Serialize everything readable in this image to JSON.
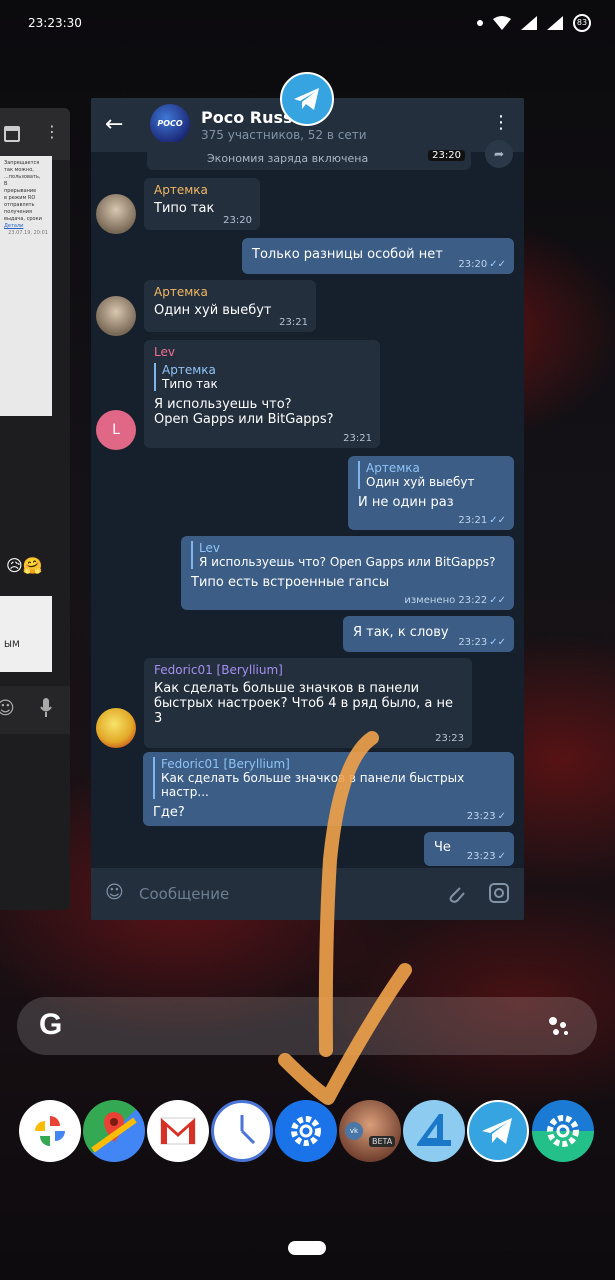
{
  "status_bar": {
    "time": "23:23:30",
    "battery": "83"
  },
  "left_card": {
    "doc_lines": [
      "Запрещается",
      "так можно,",
      "...пользовать,",
      "В",
      "прерывание",
      "в режим RO",
      "отправлять",
      "получения",
      "выдача, сроки"
    ],
    "doc_link": "Детали",
    "doc_date": "23.07.19, 20:01",
    "paper_text": "ЫМ"
  },
  "chat": {
    "title": "Poco Russia",
    "subtitle": "375 участников, 52 в сети",
    "avatar_text": "POCO",
    "service_text": "Экономия заряда включена",
    "service_time": "23:20",
    "input_placeholder": "Сообщение",
    "messages": [
      {
        "sender": "Артемка",
        "text": "Типо так",
        "time": "23:20"
      },
      {
        "text": "Только разницы особой нет",
        "time": "23:20",
        "status": "✓✓"
      },
      {
        "sender": "Артемка",
        "text": "Один хуй выебут",
        "time": "23:21"
      },
      {
        "sender": "Lev",
        "reply_name": "Артемка",
        "reply_text": "Типо так",
        "text_line1": "Я используешь что?",
        "text_line2": "Open Gapps или BitGapps?",
        "time": "23:21",
        "avatar_letter": "L"
      },
      {
        "reply_name": "Артемка",
        "reply_text": "Один хуй выебут",
        "text": "И не один раз",
        "time": "23:21",
        "status": "✓✓"
      },
      {
        "reply_name": "Lev",
        "reply_text": "Я используешь что?  Open Gapps или BitGapps?",
        "text": "Типо есть встроенные гапсы",
        "edited": "изменено",
        "time": "23:22",
        "status": "✓✓"
      },
      {
        "text": "Я так, к слову",
        "time": "23:23",
        "status": "✓✓"
      },
      {
        "sender": "Fedoric01 [Beryllium]",
        "text_line1": "Как сделать больше значков в панели",
        "text_line2": "быстрых настроек? Чтоб 4 в ряд было, а не",
        "text_line3": "3",
        "time": "23:23"
      },
      {
        "reply_name": "Fedoric01 [Beryllium]",
        "reply_text": "Как сделать больше значков в панели быстрых настр...",
        "text": "Где?",
        "time": "23:23",
        "status": "✓"
      },
      {
        "text": "Че",
        "time": "23:23",
        "status": "✓"
      }
    ]
  },
  "dock": {
    "apps": [
      "Google Photos",
      "Google Maps",
      "Gmail",
      "Clock",
      "Settings",
      "VK Beta",
      "Aurora",
      "Telegram",
      "Settings Alt"
    ],
    "vk_badge": "BETA"
  },
  "colors": {
    "accent": "#36a4e0",
    "out_bubble": "#3c5e86",
    "in_bubble": "#232f3d",
    "scribble": "#f0a24a"
  }
}
